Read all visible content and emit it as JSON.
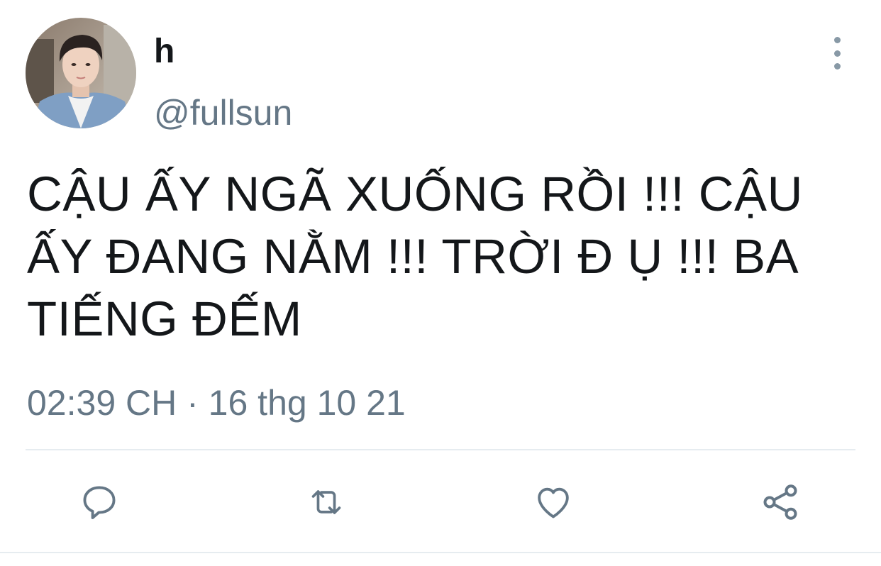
{
  "tweet": {
    "display_name": "h",
    "handle": "@fullsun",
    "text": "CẬU ẤY NGÃ XUỐNG RỒI !!! CẬU ẤY ĐANG NẰM !!! TRỜI Đ Ụ !!! BA TIẾNG ĐẾM",
    "timestamp": "02:39 CH · 16 thg 10 21"
  },
  "icons": {
    "avatar": "avatar-photo",
    "more": "more-vertical-icon",
    "reply": "reply-icon",
    "retweet": "retweet-icon",
    "like": "heart-icon",
    "share": "share-icon"
  },
  "colors": {
    "text": "#14171a",
    "secondary": "#657786",
    "icon": "#657786",
    "divider": "#e6ecf0"
  }
}
